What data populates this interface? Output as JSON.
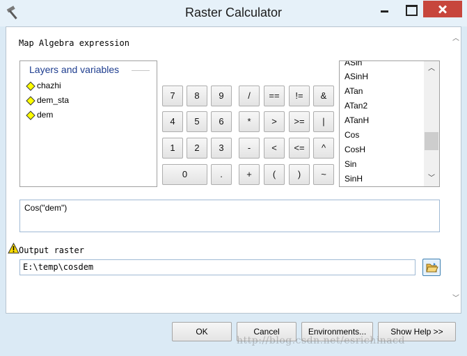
{
  "window": {
    "title": "Raster Calculator",
    "icons": {
      "app": "hammer-icon",
      "minimize": "minimize-icon",
      "maximize": "maximize-icon",
      "close": "close-icon"
    }
  },
  "expression_section": {
    "label": "Map Algebra expression"
  },
  "layers": {
    "title": "Layers and variables",
    "items": [
      {
        "label": "chazhi"
      },
      {
        "label": "dem_sta"
      },
      {
        "label": "dem"
      }
    ]
  },
  "keypad": {
    "rows": [
      [
        "7",
        "8",
        "9",
        "/",
        "==",
        "!=",
        "&"
      ],
      [
        "4",
        "5",
        "6",
        "*",
        ">",
        ">=",
        "|"
      ],
      [
        "1",
        "2",
        "3",
        "-",
        "<",
        "<=",
        "^"
      ],
      [
        "0",
        ".",
        "+",
        "(",
        ")",
        "~"
      ]
    ]
  },
  "functions": {
    "items": [
      "ASin",
      "ASinH",
      "ATan",
      "ATan2",
      "ATanH",
      "Cos",
      "CosH",
      "Sin",
      "SinH"
    ]
  },
  "expression": {
    "value": "Cos(\"dem\")"
  },
  "output": {
    "label": "Output raster",
    "value": "E:\\temp\\cosdem"
  },
  "buttons": {
    "ok": "OK",
    "cancel": "Cancel",
    "environments": "Environments...",
    "show_help": "Show Help >>"
  },
  "watermark": "http://blog.csdn.net/esrichinacd",
  "colors": {
    "accent_title": "#1e3d8f",
    "close_button": "#c7463c",
    "diamond_fill": "#ffff00"
  }
}
